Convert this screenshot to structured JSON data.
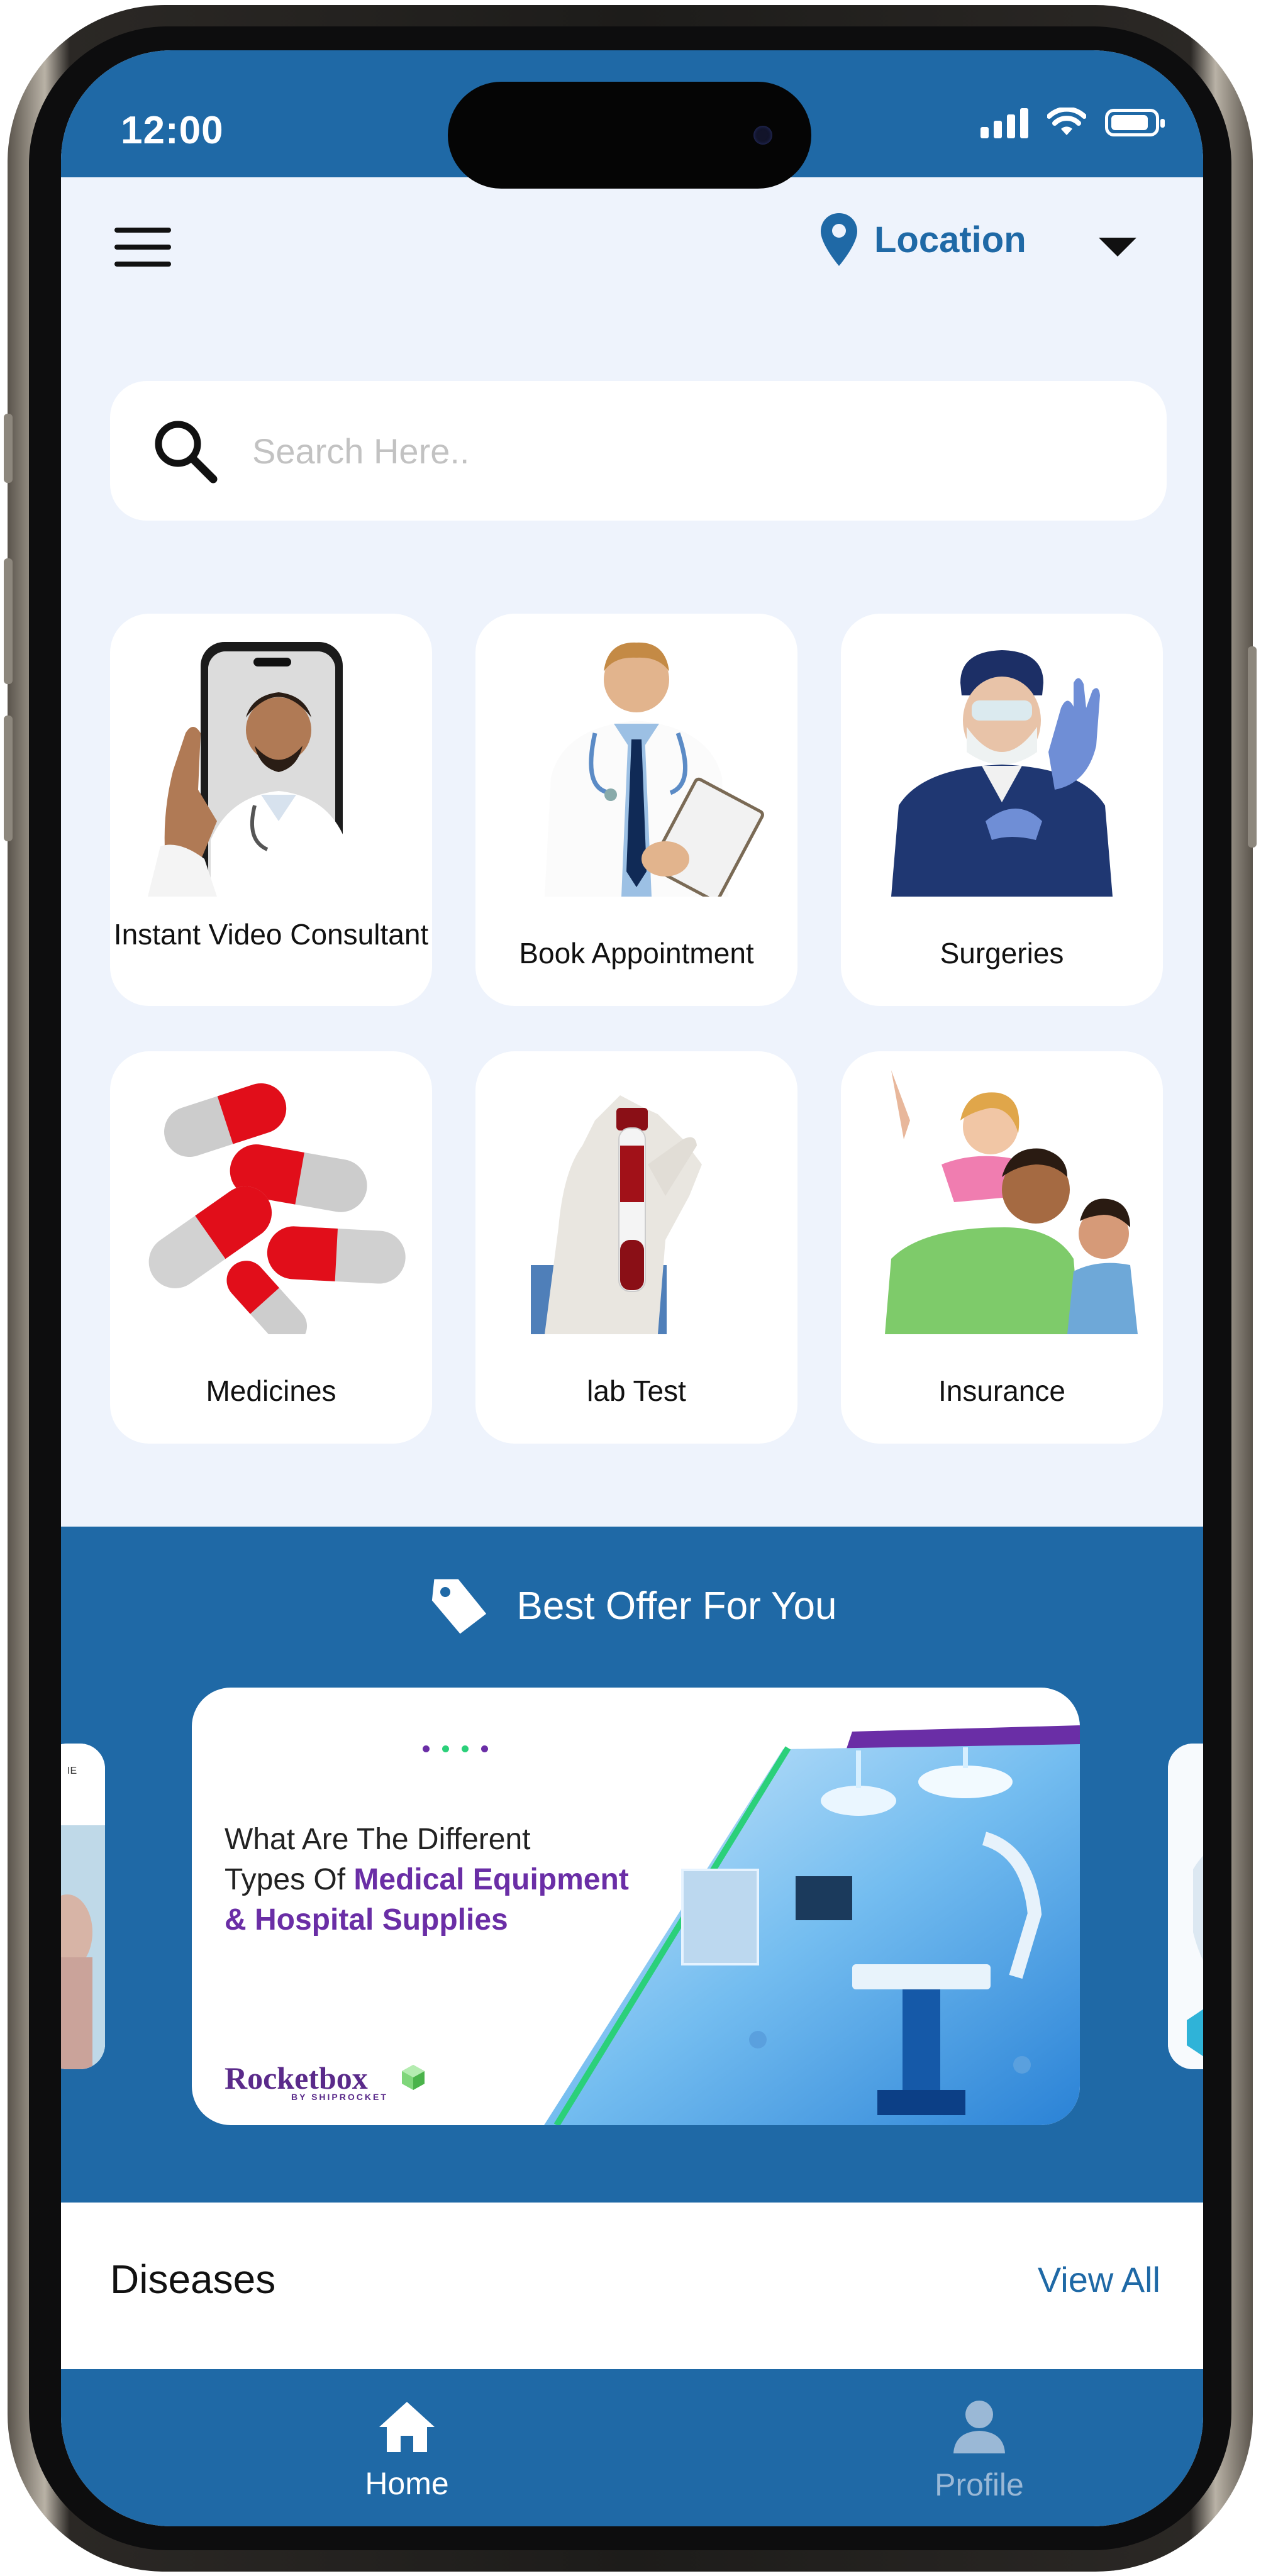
{
  "status_bar": {
    "time": "12:00"
  },
  "header": {
    "location_label": "Location"
  },
  "search": {
    "placeholder": "Search Here.."
  },
  "services": [
    {
      "label": "Instant Video Consultant",
      "icon": "video-consult-doctor"
    },
    {
      "label": "Book Appointment",
      "icon": "doctor-clipboard"
    },
    {
      "label": "Surgeries",
      "icon": "surgeon"
    },
    {
      "label": "Medicines",
      "icon": "pill-capsules"
    },
    {
      "label": "lab Test",
      "icon": "blood-test-tube"
    },
    {
      "label": "Insurance",
      "icon": "family"
    }
  ],
  "offers": {
    "title": "Best Offer For You",
    "banner": {
      "line1": "What Are The Different",
      "line2_plain": "Types Of ",
      "line2_bold": "Medical Equipment",
      "line3_bold": "& Hospital Supplies",
      "brand": "Rocketbox",
      "brand_sub": "BY SHIPROCKET"
    }
  },
  "diseases": {
    "title": "Diseases",
    "view_all": "View All"
  },
  "tabbar": {
    "home": "Home",
    "profile": "Profile"
  },
  "colors": {
    "primary": "#1f69a6",
    "background": "#eef3fc",
    "card": "#ffffff",
    "accent_purple": "#6a2ea6",
    "inactive_tab": "#9ab8d6"
  }
}
